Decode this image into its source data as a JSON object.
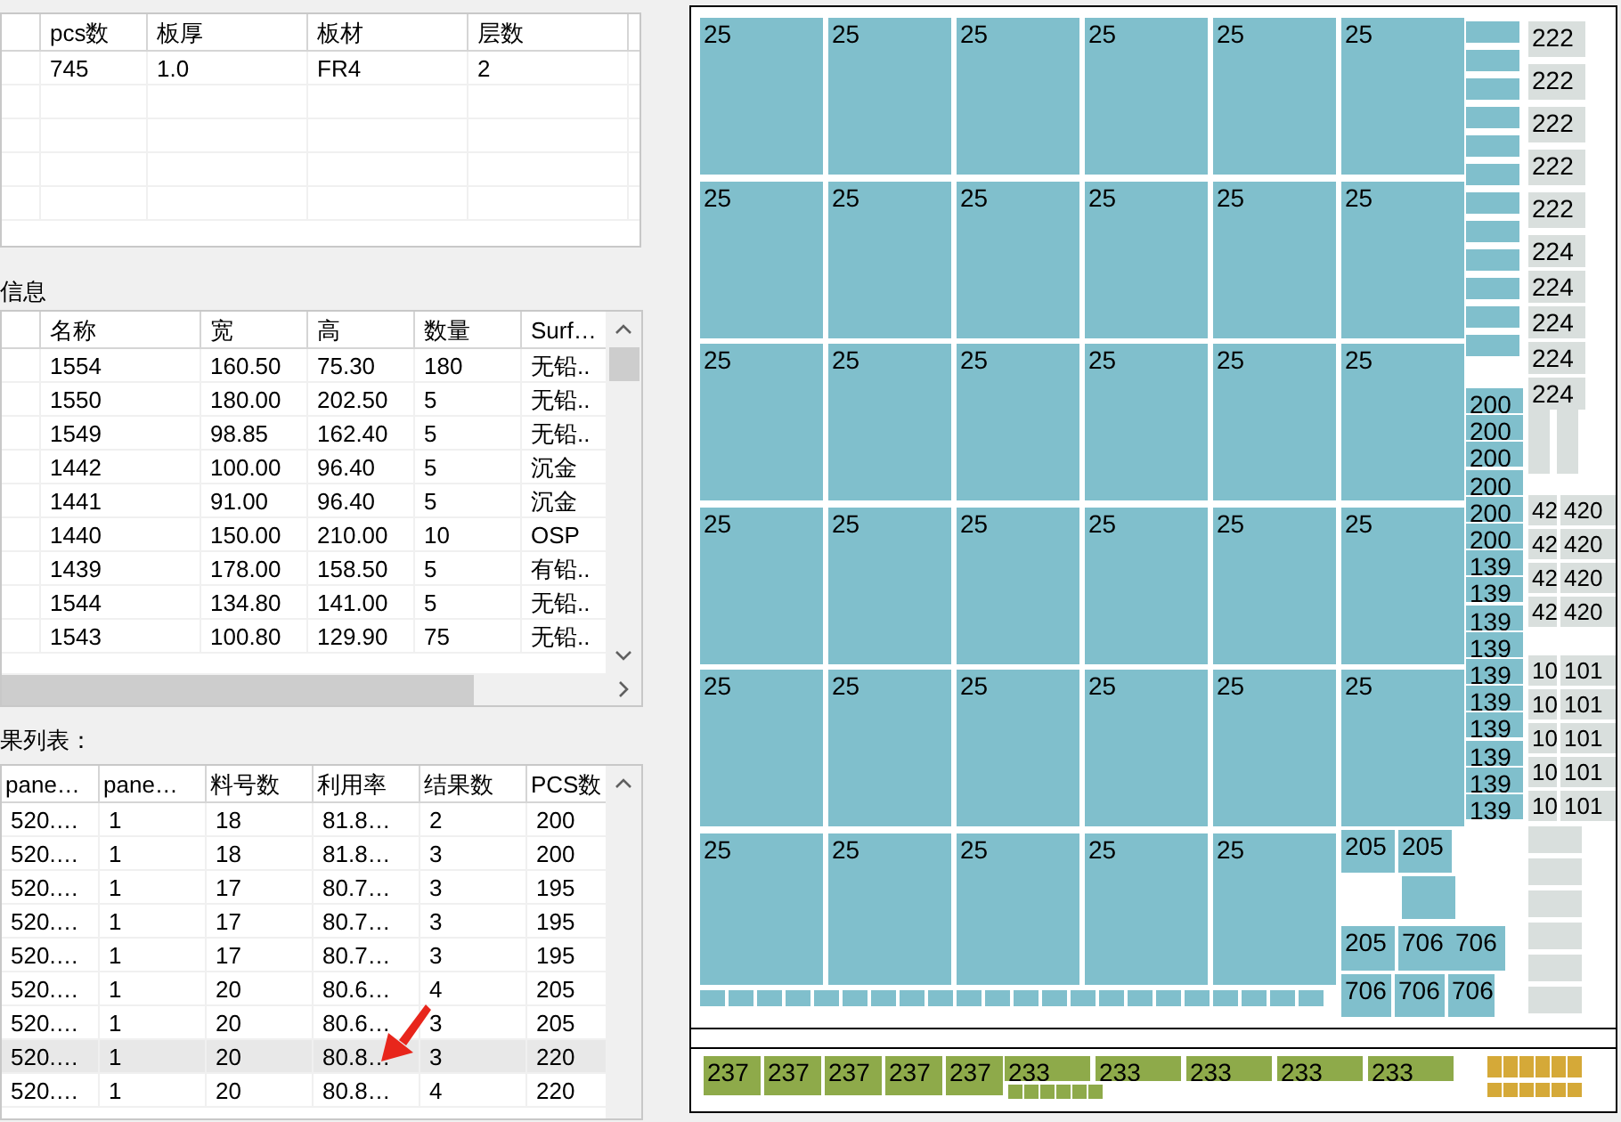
{
  "board_table": {
    "columns": [
      "pcs数",
      "板厚",
      "板材",
      "层数"
    ],
    "rows": [
      [
        "745",
        "1.0",
        "FR4",
        "2"
      ]
    ]
  },
  "parts_section": {
    "label": "信息",
    "columns": [
      "名称",
      "宽",
      "高",
      "数量",
      "Surf…"
    ],
    "rows": [
      [
        "1554",
        "160.50",
        "75.30",
        "180",
        "无铅.."
      ],
      [
        "1550",
        "180.00",
        "202.50",
        "5",
        "无铅.."
      ],
      [
        "1549",
        "98.85",
        "162.40",
        "5",
        "无铅.."
      ],
      [
        "1442",
        "100.00",
        "96.40",
        "5",
        "沉金"
      ],
      [
        "1441",
        "91.00",
        "96.40",
        "5",
        "沉金"
      ],
      [
        "1440",
        "150.00",
        "210.00",
        "10",
        "OSP"
      ],
      [
        "1439",
        "178.00",
        "158.50",
        "5",
        "有铅.."
      ],
      [
        "1544",
        "134.80",
        "141.00",
        "5",
        "无铅.."
      ],
      [
        "1543",
        "100.80",
        "129.90",
        "75",
        "无铅.."
      ]
    ]
  },
  "results_section": {
    "label": "果列表：",
    "columns": [
      "pane…",
      "pane…",
      "料号数",
      "利用率",
      "结果数",
      "PCS数"
    ],
    "rows": [
      {
        "cells": [
          "520.…",
          "1",
          "18",
          "81.8…",
          "2",
          "200"
        ],
        "selected": false
      },
      {
        "cells": [
          "520.…",
          "1",
          "18",
          "81.8…",
          "3",
          "200"
        ],
        "selected": false
      },
      {
        "cells": [
          "520.…",
          "1",
          "17",
          "80.7…",
          "3",
          "195"
        ],
        "selected": false
      },
      {
        "cells": [
          "520.…",
          "1",
          "17",
          "80.7…",
          "3",
          "195"
        ],
        "selected": false
      },
      {
        "cells": [
          "520.…",
          "1",
          "17",
          "80.7…",
          "3",
          "195"
        ],
        "selected": false
      },
      {
        "cells": [
          "520.…",
          "1",
          "20",
          "80.6…",
          "4",
          "205"
        ],
        "selected": false
      },
      {
        "cells": [
          "520.…",
          "1",
          "20",
          "80.6…",
          "3",
          "205"
        ],
        "selected": false
      },
      {
        "cells": [
          "520.…",
          "1",
          "20",
          "80.8…",
          "3",
          "220"
        ],
        "selected": true
      },
      {
        "cells": [
          "520.…",
          "1",
          "20",
          "80.8…",
          "4",
          "220"
        ],
        "selected": false
      }
    ]
  },
  "nesting_view": {
    "groups": [
      {
        "kind": "grid",
        "color": "#80bfcc",
        "pieces": [
          "25",
          "25",
          "25",
          "25",
          "25",
          "25",
          "25",
          "25",
          "25",
          "25",
          "25",
          "25",
          "25",
          "25",
          "25",
          "25",
          "25",
          "25",
          "25",
          "25",
          "25",
          "25",
          "25",
          "25",
          "25",
          "25",
          "25",
          "25",
          "25",
          "25",
          "25",
          "25",
          "25",
          "25",
          "25"
        ]
      },
      {
        "kind": "block",
        "color": "#80bfcc",
        "pieces": [
          "205",
          "205",
          "205",
          "706",
          "706",
          "706",
          "706",
          "706"
        ]
      },
      {
        "kind": "column_200",
        "color": "#80bfcc",
        "pieces": [
          "200",
          "200",
          "200",
          "200",
          "200",
          "200",
          "139",
          "139",
          "139",
          "139",
          "139",
          "139",
          "139",
          "139",
          "139",
          "139"
        ]
      },
      {
        "kind": "column_222",
        "color": "#d9dfdd",
        "pieces": [
          "222",
          "222",
          "222",
          "222",
          "222",
          "224",
          "224",
          "224",
          "224",
          "224"
        ]
      },
      {
        "kind": "column_424",
        "color": "#d9dfdd",
        "pieces": [
          "42",
          "420",
          "42",
          "420",
          "42",
          "420",
          "42",
          "420",
          "10",
          "101",
          "10",
          "101",
          "10",
          "101",
          "10",
          "101",
          "10",
          "101"
        ]
      },
      {
        "kind": "strip_237",
        "color": "#8eaa4a",
        "pieces": [
          "237",
          "237",
          "237",
          "237",
          "237"
        ]
      },
      {
        "kind": "strip_233",
        "color": "#8eaa4a",
        "pieces": [
          "233",
          "233",
          "233",
          "233",
          "233"
        ]
      },
      {
        "kind": "gold",
        "color": "#d5a938"
      }
    ]
  }
}
